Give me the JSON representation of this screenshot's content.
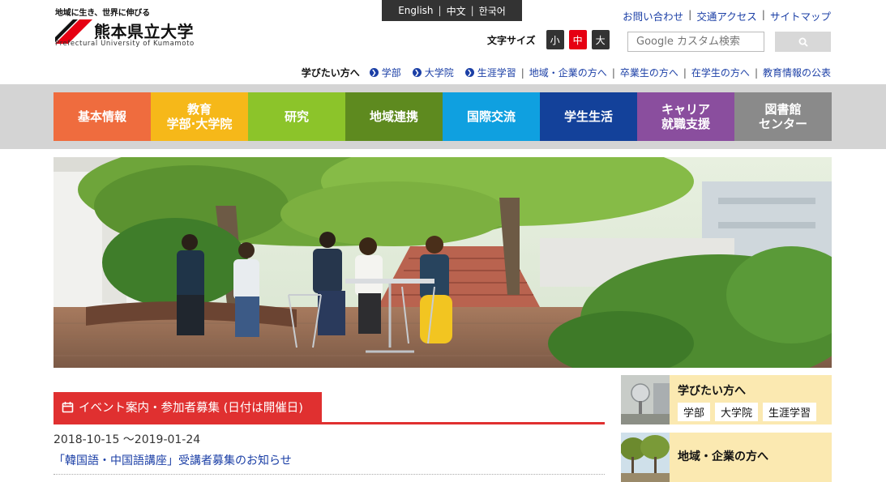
{
  "logo": {
    "tagline": "地域に生き、世界に伸びる",
    "name": "熊本県立大学",
    "name_en": "Prefectural University of Kumamoto",
    "mark_color": "#e60012"
  },
  "languages": [
    "English",
    "中文",
    "한국어"
  ],
  "util_links": [
    "お問い合わせ",
    "交通アクセス",
    "サイトマップ"
  ],
  "font_size": {
    "label": "文字サイズ",
    "options": [
      "小",
      "中",
      "大"
    ],
    "selected": "中"
  },
  "search": {
    "placeholder": "Google カスタム検索",
    "button_icon": "search-icon"
  },
  "audience": {
    "label": "学びたい方へ",
    "dot_links": [
      "学部",
      "大学院",
      "生涯学習"
    ],
    "links": [
      "地域・企業の方へ",
      "卒業生の方へ",
      "在学生の方へ",
      "教育情報の公表"
    ]
  },
  "nav": [
    {
      "label": "基本情報",
      "color": "#ef6c3e"
    },
    {
      "label": "教育\n学部·大学院",
      "color": "#f6b819"
    },
    {
      "label": "研究",
      "color": "#8cc42a"
    },
    {
      "label": "地域連携",
      "color": "#5e8a1f"
    },
    {
      "label": "国際交流",
      "color": "#0fa0e0"
    },
    {
      "label": "学生生活",
      "color": "#13419a"
    },
    {
      "label": "キャリア\n就職支援",
      "color": "#8a4e9e"
    },
    {
      "label": "図書館\nセンター",
      "color": "#8a8a8a"
    }
  ],
  "events": {
    "heading": "イベント案内・参加者募集 (日付は開催日)",
    "heading_icon": "calendar-icon",
    "items": [
      {
        "date": "2018-10-15 ～2019-01-24",
        "title": "「韓国語・中国語講座」受講者募集のお知らせ"
      }
    ]
  },
  "side": {
    "learners": {
      "title": "学びたい方へ",
      "chips": [
        "学部",
        "大学院",
        "生涯学習"
      ]
    },
    "community": {
      "title": "地域・企業の方へ"
    }
  }
}
